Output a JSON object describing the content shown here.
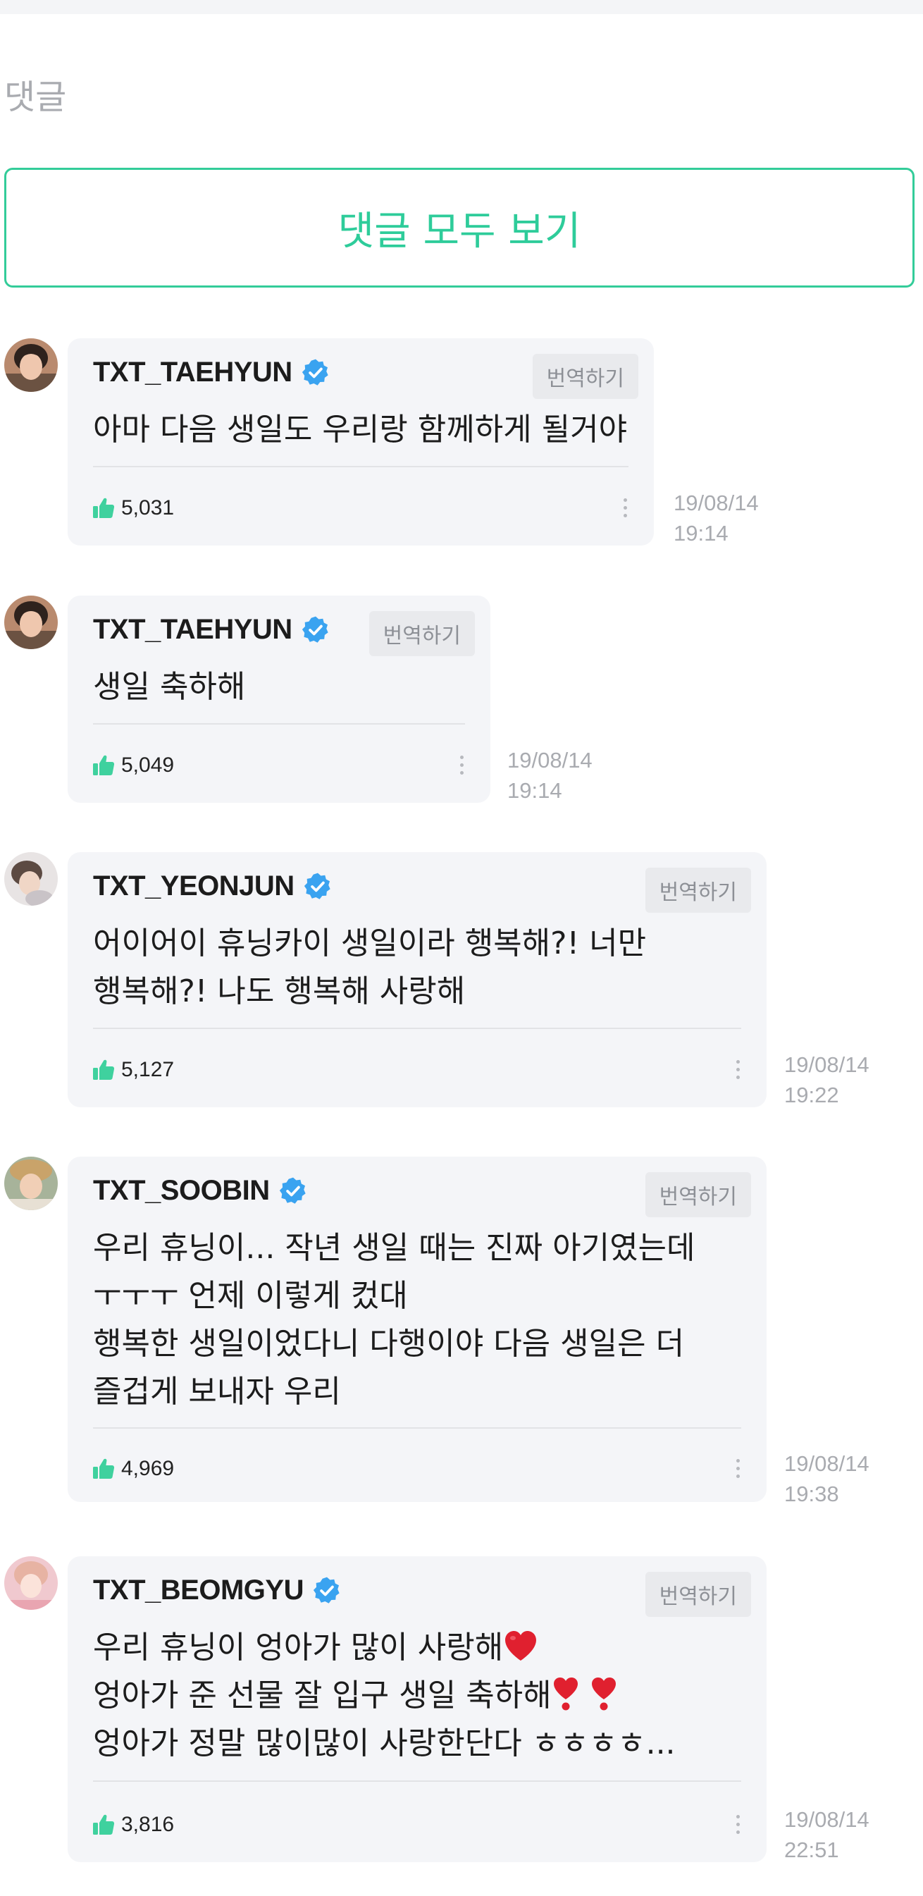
{
  "section": {
    "title": "댓글",
    "view_all_label": "댓글 모두 보기"
  },
  "accent_color": "#2ecc9a",
  "icons": {
    "verified": "verified-badge-icon",
    "like": "thumbs-up-icon",
    "more": "more-vertical-icon",
    "heart": "red-heart-emoji",
    "exclamation_heart": "heart-exclamation-emoji"
  },
  "comments": [
    {
      "author": "TXT_TAEHYUN",
      "translate_label": "번역하기",
      "lines": [
        "아마 다음 생일도 우리랑 함께하게 될거야"
      ],
      "likes": "5,031",
      "date": "19/08/14",
      "time": "19:14"
    },
    {
      "author": "TXT_TAEHYUN",
      "translate_label": "번역하기",
      "lines": [
        "생일 축하해"
      ],
      "likes": "5,049",
      "date": "19/08/14",
      "time": "19:14"
    },
    {
      "author": "TXT_YEONJUN",
      "translate_label": "번역하기",
      "lines": [
        "어이어이 휴닝카이 생일이라 행복해?! 너만",
        "행복해?! 나도 행복해 사랑해"
      ],
      "likes": "5,127",
      "date": "19/08/14",
      "time": "19:22"
    },
    {
      "author": "TXT_SOOBIN",
      "translate_label": "번역하기",
      "lines": [
        "우리 휴닝이... 작년 생일 때는 진짜 아기였는데",
        "ㅜㅜㅜ 언제 이렇게 컸대",
        "행복한 생일이었다니 다행이야 다음 생일은 더",
        "즐겁게 보내자 우리"
      ],
      "likes": "4,969",
      "date": "19/08/14",
      "time": "19:38"
    },
    {
      "author": "TXT_BEOMGYU",
      "translate_label": "번역하기",
      "lines": [
        "우리 휴닝이 엉아가 많이 사랑해",
        "엉아가 준 선물 잘 입구 생일 축하해",
        "엉아가 정말 많이많이 사랑한단다 ㅎㅎㅎㅎ..."
      ],
      "likes": "3,816",
      "date": "19/08/14",
      "time": "22:51"
    }
  ]
}
